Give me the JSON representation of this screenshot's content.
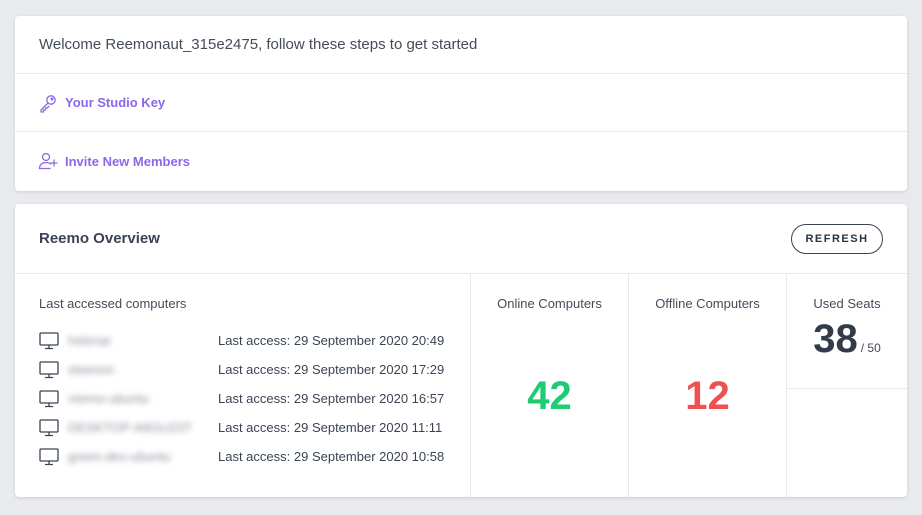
{
  "welcome": {
    "text": "Welcome Reemonaut_315e2475, follow these steps to get started",
    "steps": [
      {
        "label": "Your Studio Key",
        "icon": "key-icon"
      },
      {
        "label": "Invite New Members",
        "icon": "add-user-icon"
      }
    ]
  },
  "overview": {
    "title": "Reemo Overview",
    "refresh_label": "REFRESH",
    "last_accessed_title": "Last accessed computers",
    "computers": [
      {
        "name": "helenar",
        "access": "Last access: 29 September 2020 20:49"
      },
      {
        "name": "steenon",
        "access": "Last access: 29 September 2020 17:29"
      },
      {
        "name": "reemo-ubuntu",
        "access": "Last access: 29 September 2020 16:57"
      },
      {
        "name": "DESKTOP-A8GU23T",
        "access": "Last access: 29 September 2020 11:11"
      },
      {
        "name": "green-dev-ubuntu",
        "access": "Last access: 29 September 2020 10:58"
      }
    ],
    "online_label": "Online Computers",
    "online_value": "42",
    "offline_label": "Offline Computers",
    "offline_value": "12",
    "seats_label": "Used Seats",
    "seats_used": "38",
    "seats_total": "/ 50"
  },
  "colors": {
    "accent": "#8b68e6",
    "online": "#1fcc73",
    "offline": "#ef5050",
    "background": "#e8eaee"
  }
}
